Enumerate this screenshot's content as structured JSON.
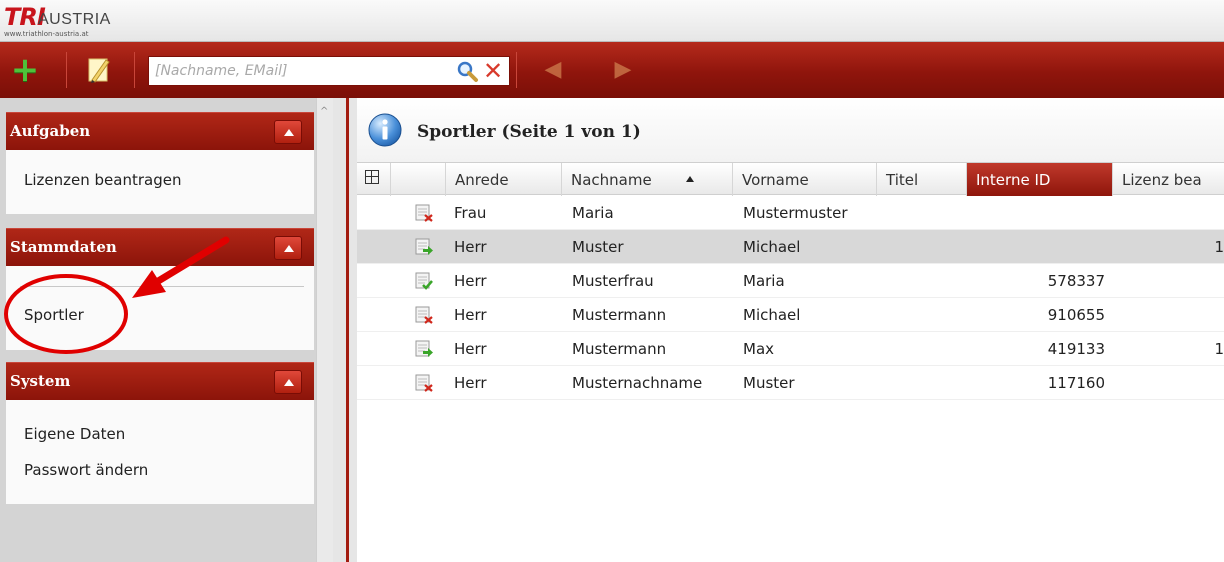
{
  "logo": {
    "tri": "TRI",
    "brand": "AUSTRIA",
    "url": "www.triathlon-austria.at"
  },
  "toolbar": {
    "add_icon": "plus-icon",
    "edit_icon": "pencil-icon",
    "search_placeholder": "[Nachname, EMail]",
    "search_icon": "magnifier-icon",
    "clear_icon": "red-x-icon",
    "back_icon": "arrow-left-icon",
    "forward_icon": "arrow-right-icon"
  },
  "sidebar": {
    "panels": [
      {
        "title": "Aufgaben",
        "items": [
          "Lizenzen beantragen"
        ]
      },
      {
        "title": "Stammdaten",
        "items": [
          "Sportler"
        ]
      },
      {
        "title": "System",
        "items": [
          "Eigene Daten",
          "Passwort ändern"
        ]
      }
    ]
  },
  "main": {
    "title": "Sportler (Seite 1 von 1)",
    "columns": [
      "Anrede",
      "Nachname",
      "Vorname",
      "Titel",
      "Interne ID",
      "Lizenz bea"
    ],
    "sorted_column": "Nachname",
    "sort_direction": "ascending",
    "active_column": "Interne ID",
    "rows": [
      {
        "status": "rejected",
        "anrede": "Frau",
        "nachname": "Maria",
        "vorname": "Mustermuster",
        "titel": "",
        "interne_id": "",
        "lizenz": ""
      },
      {
        "status": "forward",
        "anrede": "Herr",
        "nachname": "Muster",
        "vorname": "Michael",
        "titel": "",
        "interne_id": "",
        "lizenz": "1",
        "selected": true
      },
      {
        "status": "approved",
        "anrede": "Herr",
        "nachname": "Musterfrau",
        "vorname": "Maria",
        "titel": "",
        "interne_id": "578337",
        "lizenz": ""
      },
      {
        "status": "rejected",
        "anrede": "Herr",
        "nachname": "Mustermann",
        "vorname": "Michael",
        "titel": "",
        "interne_id": "910655",
        "lizenz": ""
      },
      {
        "status": "forward",
        "anrede": "Herr",
        "nachname": "Mustermann",
        "vorname": "Max",
        "titel": "",
        "interne_id": "419133",
        "lizenz": "1"
      },
      {
        "status": "rejected",
        "anrede": "Herr",
        "nachname": "Musternachname",
        "vorname": "Muster",
        "titel": "",
        "interne_id": "117160",
        "lizenz": ""
      }
    ]
  },
  "annotation": {
    "color": "#e00000",
    "target": "Sportler"
  }
}
